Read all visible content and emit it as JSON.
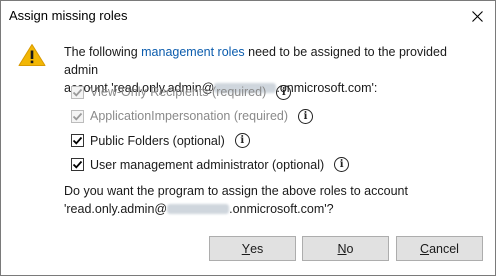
{
  "dialog": {
    "title": "Assign missing roles",
    "message_prefix": "The following ",
    "message_link": "management roles",
    "message_suffix_1": " need to be assigned to the provided admin",
    "message_line2_prefix": "account 'read.only.admin@",
    "message_line2_suffix": ".onmicrosoft.com':",
    "question_line1": "Do you want the program to assign the above roles to account",
    "question_line2_prefix": "'read.only.admin@",
    "question_line2_suffix": ".onmicrosoft.com'?"
  },
  "roles": [
    {
      "label": "View-Only Recipients (required)",
      "checked": true,
      "disabled": true
    },
    {
      "label": "ApplicationImpersonation (required)",
      "checked": true,
      "disabled": true
    },
    {
      "label": "Public Folders (optional)",
      "checked": true,
      "disabled": false
    },
    {
      "label": "User management administrator (optional)",
      "checked": true,
      "disabled": false
    }
  ],
  "buttons": {
    "yes_mnemonic": "Y",
    "yes_rest": "es",
    "no_mnemonic": "N",
    "no_rest": "o",
    "cancel_mnemonic": "C",
    "cancel_rest": "ancel"
  },
  "icons": {
    "warning": "warning-icon",
    "close": "close-icon",
    "info": "info-icon",
    "info_glyph": "i"
  },
  "colors": {
    "link": "#0b5cad",
    "warning_fill": "#f2b705"
  }
}
